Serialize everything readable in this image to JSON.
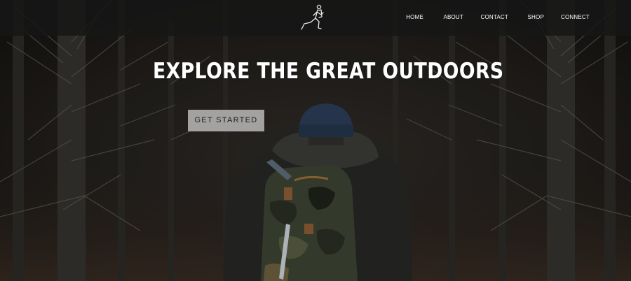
{
  "header": {
    "logo_icon": "hiker-running-logo-icon",
    "nav": [
      {
        "label": "HOME"
      },
      {
        "label": "ABOUT"
      },
      {
        "label": "CONTACT"
      },
      {
        "label": "SHOP"
      },
      {
        "label": "CONNECT"
      }
    ]
  },
  "hero": {
    "title": "EXPLORE THE GREAT OUTDOORS",
    "cta_label": "GET STARTED",
    "background_image": "hiker-with-camo-backpack-in-bare-forest"
  },
  "colors": {
    "header_bg": "#161616",
    "text": "#ffffff",
    "cta_bg": "#a3a2a1",
    "cta_text": "#1d1d1d"
  }
}
